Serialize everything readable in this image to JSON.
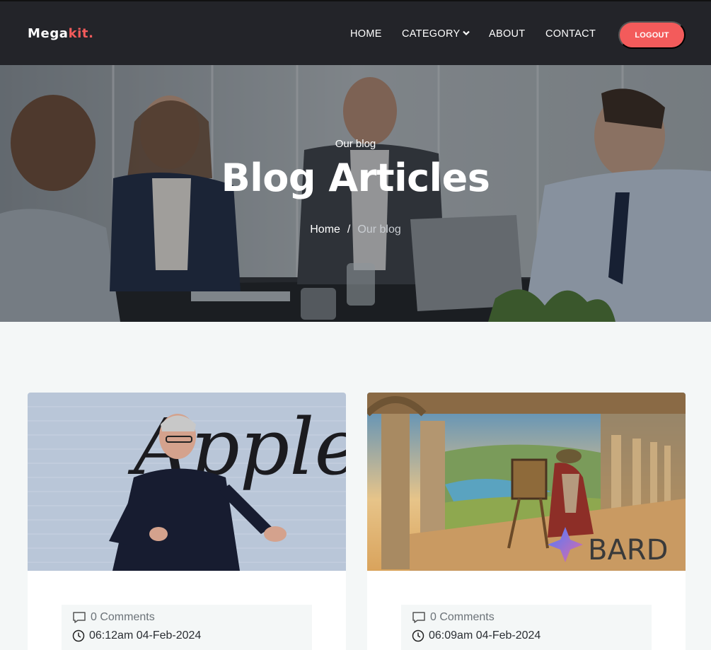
{
  "brand": {
    "name": "Mega",
    "accent": "kit."
  },
  "nav": {
    "home": "HOME",
    "category": "CATEGORY",
    "about": "ABOUT",
    "contact": "CONTACT",
    "logout": "LOGOUT"
  },
  "hero": {
    "subtitle": "Our blog",
    "title": "Blog Articles",
    "breadcrumb": {
      "home": "Home",
      "separator": "/",
      "current": "Our blog"
    }
  },
  "posts": [
    {
      "image_text": "Apple",
      "comments": "0 Comments",
      "date": "06:12am 04-Feb-2024"
    },
    {
      "image_text": "BARD",
      "comments": "0 Comments",
      "date": "06:09am 04-Feb-2024"
    }
  ],
  "colors": {
    "accent": "#f35b5b",
    "navbar": "#232429",
    "background": "#f4f7f7"
  }
}
